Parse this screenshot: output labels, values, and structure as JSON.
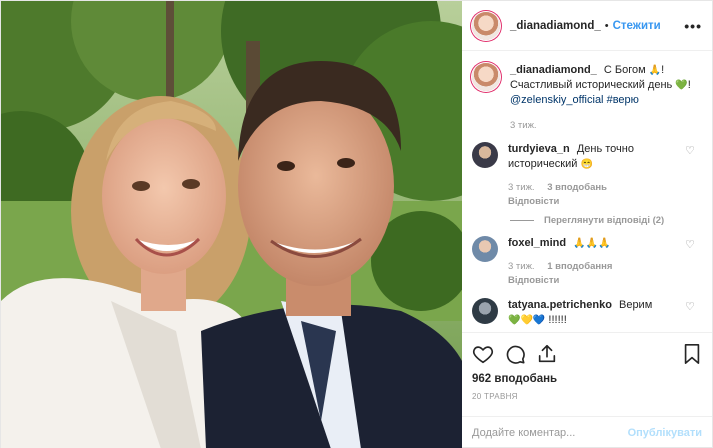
{
  "photo": {
    "alt": ""
  },
  "header": {
    "username": "_dianadiamond_",
    "separator": "•",
    "follow_label": "Стежити",
    "more_label": "•••"
  },
  "caption": {
    "username": "_dianadiamond_",
    "text_1": "С Богом",
    "emoji_1": "🙏",
    "text_2": "!",
    "text_3": "Счастливый исторический день",
    "emoji_2": "💚",
    "text_4": "!",
    "mention": "@zelenskiy_official",
    "hashtag": "#верю",
    "time": "3 тиж."
  },
  "comments": [
    {
      "username": "turdyieva_n",
      "text": "День точно исторический",
      "emoji": "😁",
      "time": "3 тиж.",
      "likes": "3 вподобань",
      "reply": "Відповісти"
    },
    {
      "username": "foxel_mind",
      "text": "",
      "emoji": "🙏🙏🙏",
      "time": "3 тиж.",
      "likes": "1 вподобання",
      "reply": "Відповісти"
    },
    {
      "username": "tatyana.petrichenko",
      "text": "Верим",
      "emoji": "💚💛💙",
      "extra": "!!!!!!",
      "time": "",
      "likes": "",
      "reply": ""
    }
  ],
  "view_replies": "Переглянути відповіді (2)",
  "actions": {
    "likes_count": "962 вподобань",
    "date": "20 ТРАВНЯ"
  },
  "add_comment": {
    "placeholder": "Додайте коментар...",
    "post_label": "Опублікувати"
  },
  "colors": {
    "link": "#003569",
    "accent": "#3897f0",
    "post_disabled": "#b2dffc",
    "muted": "#999999"
  }
}
